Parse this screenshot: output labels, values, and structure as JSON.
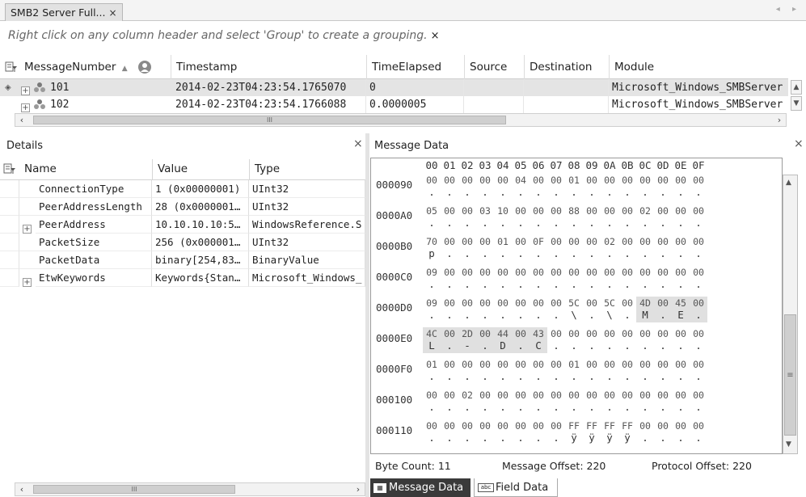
{
  "document_tab": {
    "title": "SMB2 Server Full...",
    "close": "×"
  },
  "tab_scroll": "◂ ▸",
  "group_hint": {
    "text": "Right click on any column header and select 'Group' to create a grouping.",
    "close": "×"
  },
  "message_grid": {
    "columns": [
      "MessageNumber",
      "Timestamp",
      "TimeElapsed",
      "Source",
      "Destination",
      "Module"
    ],
    "rows": [
      {
        "number": "101",
        "timestamp": "2014-02-23T04:23:54.1765070",
        "elapsed": "0",
        "source": "",
        "destination": "",
        "module": "Microsoft_Windows_SMBServer"
      },
      {
        "number": "102",
        "timestamp": "2014-02-23T04:23:54.1766088",
        "elapsed": "0.0000005",
        "source": "",
        "destination": "",
        "module": "Microsoft_Windows_SMBServer"
      }
    ],
    "hscroll_grip": "III"
  },
  "details": {
    "title": "Details",
    "close": "×",
    "columns": [
      "Name",
      "Value",
      "Type"
    ],
    "rows": [
      {
        "name": "ConnectionType",
        "value": "1 (0x00000001)",
        "type": "UInt32",
        "expandable": false
      },
      {
        "name": "PeerAddressLength",
        "value": "28 (0x0000001…",
        "type": "UInt32",
        "expandable": false
      },
      {
        "name": "PeerAddress",
        "value": "10.10.10.10:5…",
        "type": "WindowsReference.S",
        "expandable": true
      },
      {
        "name": "PacketSize",
        "value": "256 (0x000001…",
        "type": "UInt32",
        "expandable": false
      },
      {
        "name": "PacketData",
        "value": "binary[254,83…",
        "type": "BinaryValue",
        "expandable": false
      },
      {
        "name": "EtwKeywords",
        "value": "Keywords{Stan…",
        "type": "Microsoft_Windows_",
        "expandable": true
      }
    ],
    "hscroll_grip": "III"
  },
  "message_data": {
    "title": "Message Data",
    "close": "×",
    "column_headers": [
      "00",
      "01",
      "02",
      "03",
      "04",
      "05",
      "06",
      "07",
      "08",
      "09",
      "0A",
      "0B",
      "0C",
      "0D",
      "0E",
      "0F"
    ],
    "rows": [
      {
        "offset": "000090",
        "bytes": [
          "00",
          "00",
          "00",
          "00",
          "00",
          "04",
          "00",
          "00",
          "01",
          "00",
          "00",
          "00",
          "00",
          "00",
          "00",
          "00"
        ],
        "ascii": [
          ".",
          ".",
          ".",
          ".",
          ".",
          ".",
          ".",
          ".",
          ".",
          ".",
          ".",
          ".",
          ".",
          ".",
          ".",
          "."
        ],
        "hl": []
      },
      {
        "offset": "0000A0",
        "bytes": [
          "05",
          "00",
          "00",
          "03",
          "10",
          "00",
          "00",
          "00",
          "88",
          "00",
          "00",
          "00",
          "02",
          "00",
          "00",
          "00"
        ],
        "ascii": [
          ".",
          ".",
          ".",
          ".",
          ".",
          ".",
          ".",
          ".",
          ".",
          ".",
          ".",
          ".",
          ".",
          ".",
          ".",
          "."
        ],
        "hl": []
      },
      {
        "offset": "0000B0",
        "bytes": [
          "70",
          "00",
          "00",
          "00",
          "01",
          "00",
          "0F",
          "00",
          "00",
          "00",
          "02",
          "00",
          "00",
          "00",
          "00",
          "00"
        ],
        "ascii": [
          "p",
          ".",
          ".",
          ".",
          ".",
          ".",
          ".",
          ".",
          ".",
          ".",
          ".",
          ".",
          ".",
          ".",
          ".",
          "."
        ],
        "hl": []
      },
      {
        "offset": "0000C0",
        "bytes": [
          "09",
          "00",
          "00",
          "00",
          "00",
          "00",
          "00",
          "00",
          "00",
          "00",
          "00",
          "00",
          "00",
          "00",
          "00",
          "00"
        ],
        "ascii": [
          ".",
          ".",
          ".",
          ".",
          ".",
          ".",
          ".",
          ".",
          ".",
          ".",
          ".",
          ".",
          ".",
          ".",
          ".",
          "."
        ],
        "hl": []
      },
      {
        "offset": "0000D0",
        "bytes": [
          "09",
          "00",
          "00",
          "00",
          "00",
          "00",
          "00",
          "00",
          "5C",
          "00",
          "5C",
          "00",
          "4D",
          "00",
          "45",
          "00"
        ],
        "ascii": [
          ".",
          ".",
          ".",
          ".",
          ".",
          ".",
          ".",
          ".",
          "\\",
          ".",
          "\\",
          ".",
          "M",
          ".",
          "E",
          "."
        ],
        "hl": [
          12,
          13,
          14,
          15
        ]
      },
      {
        "offset": "0000E0",
        "bytes": [
          "4C",
          "00",
          "2D",
          "00",
          "44",
          "00",
          "43",
          "00",
          "00",
          "00",
          "00",
          "00",
          "00",
          "00",
          "00",
          "00"
        ],
        "ascii": [
          "L",
          ".",
          "-",
          ".",
          "D",
          ".",
          "C",
          ".",
          ".",
          ".",
          ".",
          ".",
          ".",
          ".",
          ".",
          "."
        ],
        "hl": [
          0,
          1,
          2,
          3,
          4,
          5,
          6
        ]
      },
      {
        "offset": "0000F0",
        "bytes": [
          "01",
          "00",
          "00",
          "00",
          "00",
          "00",
          "00",
          "00",
          "01",
          "00",
          "00",
          "00",
          "00",
          "00",
          "00",
          "00"
        ],
        "ascii": [
          ".",
          ".",
          ".",
          ".",
          ".",
          ".",
          ".",
          ".",
          ".",
          ".",
          ".",
          ".",
          ".",
          ".",
          ".",
          "."
        ],
        "hl": []
      },
      {
        "offset": "000100",
        "bytes": [
          "00",
          "00",
          "02",
          "00",
          "00",
          "00",
          "00",
          "00",
          "00",
          "00",
          "00",
          "00",
          "00",
          "00",
          "00",
          "00"
        ],
        "ascii": [
          ".",
          ".",
          ".",
          ".",
          ".",
          ".",
          ".",
          ".",
          ".",
          ".",
          ".",
          ".",
          ".",
          ".",
          ".",
          "."
        ],
        "hl": []
      },
      {
        "offset": "000110",
        "bytes": [
          "00",
          "00",
          "00",
          "00",
          "00",
          "00",
          "00",
          "00",
          "FF",
          "FF",
          "FF",
          "FF",
          "00",
          "00",
          "00",
          "00"
        ],
        "ascii": [
          ".",
          ".",
          ".",
          ".",
          ".",
          ".",
          ".",
          ".",
          "ÿ",
          "ÿ",
          "ÿ",
          "ÿ",
          ".",
          ".",
          ".",
          "."
        ],
        "hl": []
      }
    ],
    "status": {
      "byte_count": "Byte Count: 11",
      "message_offset": "Message Offset: 220",
      "protocol_offset": "Protocol Offset: 220"
    },
    "tabs": [
      "Message Data",
      "Field Data"
    ]
  },
  "icons": {
    "filter": "filter-icon",
    "group": "person-group-icon",
    "pin": "pin-icon"
  }
}
